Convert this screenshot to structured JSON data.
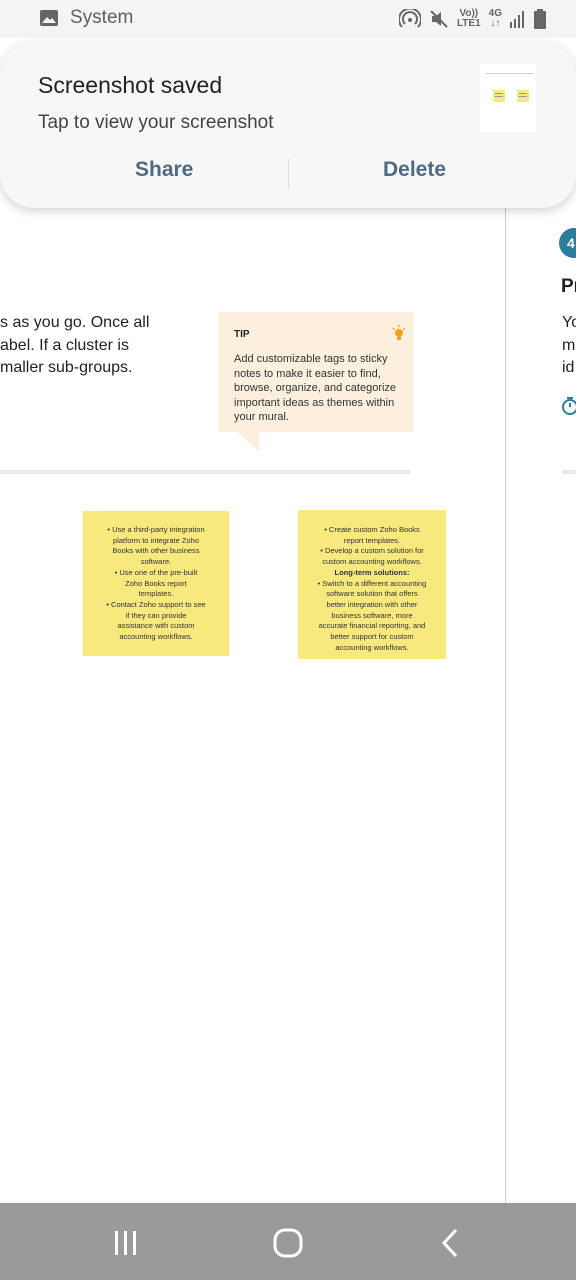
{
  "status_bar": {
    "app_name": "System",
    "icons": [
      "image-icon",
      "hotspot-icon",
      "mute-icon",
      "volte-lte-icon",
      "4g-data-icon",
      "signal-bars-icon",
      "battery-icon"
    ],
    "network_top": "Vo))",
    "network_bottom": "LTE1",
    "data_top": "4G",
    "data_bottom": "↓↑"
  },
  "notification": {
    "title": "Screenshot saved",
    "subtitle": "Tap to view your screenshot",
    "actions": {
      "share": "Share",
      "delete": "Delete"
    }
  },
  "board": {
    "body_text": [
      "s as you go. Once all",
      "abel. If a cluster is",
      "maller sub-groups."
    ],
    "tip": {
      "label": "TIP",
      "text": "Add customizable tags to sticky notes to make it easier to find, browse, organize, and categorize important ideas as themes within your mural."
    },
    "sticky_notes": [
      {
        "lines": [
          "• Use a third-party integration",
          "platform to integrate Zoho",
          "Books with other business",
          "software.",
          "• Use one of the pre-built",
          "Zoho Books report",
          "templates.",
          "• Contact Zoho support to see",
          "if they can provide",
          "assistance with custom",
          "accounting workflows."
        ]
      },
      {
        "lines": [
          "• Create custom Zoho Books",
          "report templates.",
          "• Develop a custom solution for",
          "custom accounting workflows.",
          "Long-term solutions:",
          "• Switch to a different accounting",
          "software solution that offers",
          "better integration with other",
          "business software, more",
          "accurate financial reporting, and",
          "better support for custom",
          "accounting workflows."
        ]
      }
    ],
    "next_panel": {
      "badge": "4",
      "heading": "Pr",
      "text": [
        "Yo",
        "m",
        "id"
      ]
    }
  },
  "colors": {
    "tip_background": "#fbf0de",
    "sticky_yellow": "#f7e97d",
    "badge_teal": "#2d7c9b",
    "action_blue": "#4f6b83",
    "navbar_gray": "#9a9a9a"
  },
  "nav_bar": {
    "buttons": [
      "recent-apps-icon",
      "home-icon",
      "back-icon"
    ]
  }
}
